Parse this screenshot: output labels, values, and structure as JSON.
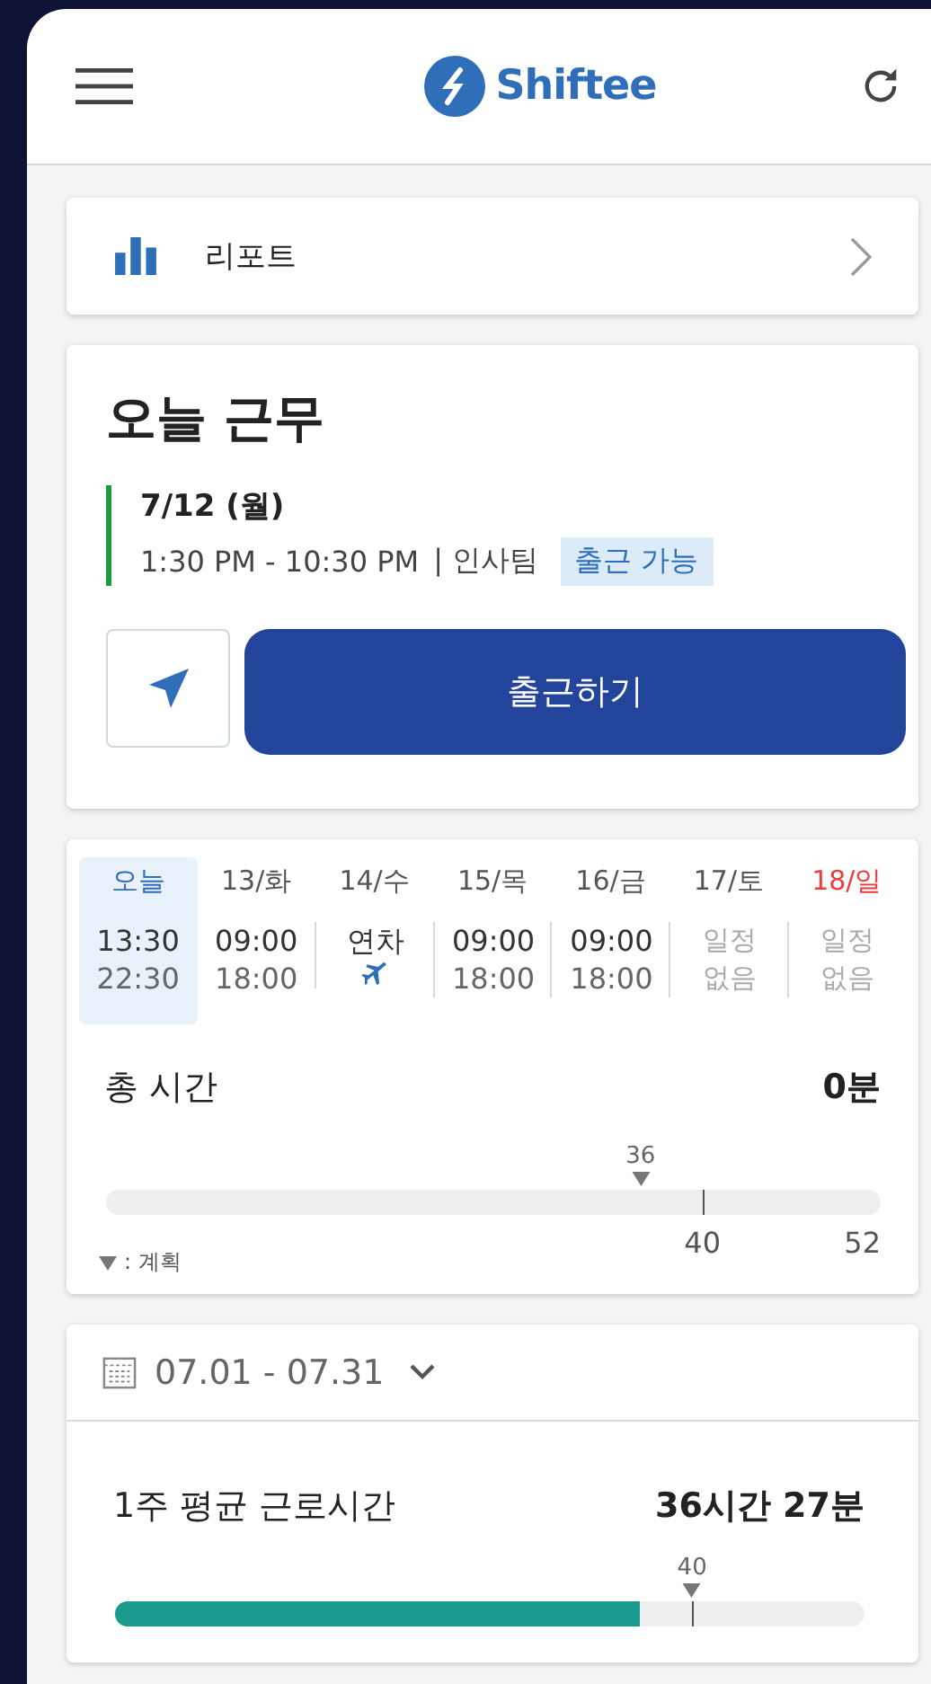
{
  "header": {
    "logo_text": "Shiftee"
  },
  "report": {
    "label": "리포트"
  },
  "today": {
    "title": "오늘 근무",
    "date": "7/12 (월)",
    "time": "1:30 PM - 10:30 PM",
    "team": "| 인사팀",
    "status": "출근 가능",
    "clock_in_button": "출근하기"
  },
  "week": {
    "days": [
      {
        "label": "오늘",
        "selected": true,
        "holiday": false,
        "kind": "shift",
        "lines": [
          "13:30",
          "22:30"
        ]
      },
      {
        "label": "13/화",
        "selected": false,
        "holiday": false,
        "kind": "shift",
        "lines": [
          "09:00",
          "18:00"
        ]
      },
      {
        "label": "14/수",
        "selected": false,
        "holiday": false,
        "kind": "leave",
        "lines": [
          "연차"
        ]
      },
      {
        "label": "15/목",
        "selected": false,
        "holiday": false,
        "kind": "shift",
        "lines": [
          "09:00",
          "18:00"
        ]
      },
      {
        "label": "16/금",
        "selected": false,
        "holiday": false,
        "kind": "shift",
        "lines": [
          "09:00",
          "18:00"
        ]
      },
      {
        "label": "17/토",
        "selected": false,
        "holiday": false,
        "kind": "none",
        "lines": [
          "일정",
          "없음"
        ]
      },
      {
        "label": "18/일",
        "selected": false,
        "holiday": true,
        "kind": "none",
        "lines": [
          "일정",
          "없음"
        ]
      }
    ],
    "total_label": "총 시간",
    "total_value": "0분",
    "gauge": {
      "planned": {
        "label": "36",
        "level": 0.69
      },
      "tick": {
        "label": "40",
        "level": 0.77
      },
      "max_label": "52"
    },
    "legend": ": 계획"
  },
  "month": {
    "range": "07.01 - 07.31",
    "avg_label": "1주 평균 근로시간",
    "avg_value": "36시간 27분",
    "gauge": {
      "level": 0.7,
      "planned": {
        "label": "40",
        "level": 0.77
      },
      "tick": {
        "level": 0.77
      }
    }
  }
}
